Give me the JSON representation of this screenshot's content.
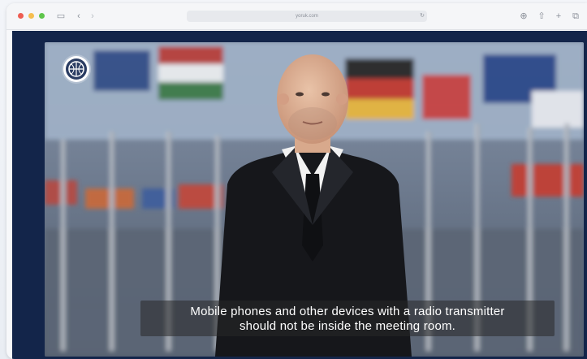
{
  "browser": {
    "url": "yoruk.com",
    "toolbar_icons": [
      "sidebar-icon",
      "back-icon",
      "forward-icon",
      "reload-icon",
      "share-icon",
      "new-tab-icon",
      "tabs-icon"
    ]
  },
  "video": {
    "subtitle_line1": "Mobile phones and other devices with a radio transmitter",
    "subtitle_line2": "should not be inside the meeting room.",
    "logo_icon": "globe-emblem-icon"
  },
  "colors": {
    "frame": "#13254a",
    "caption_bg": "#282828",
    "traffic_red": "#ee5d52",
    "traffic_yellow": "#f5be4f",
    "traffic_green": "#5ec54b"
  }
}
